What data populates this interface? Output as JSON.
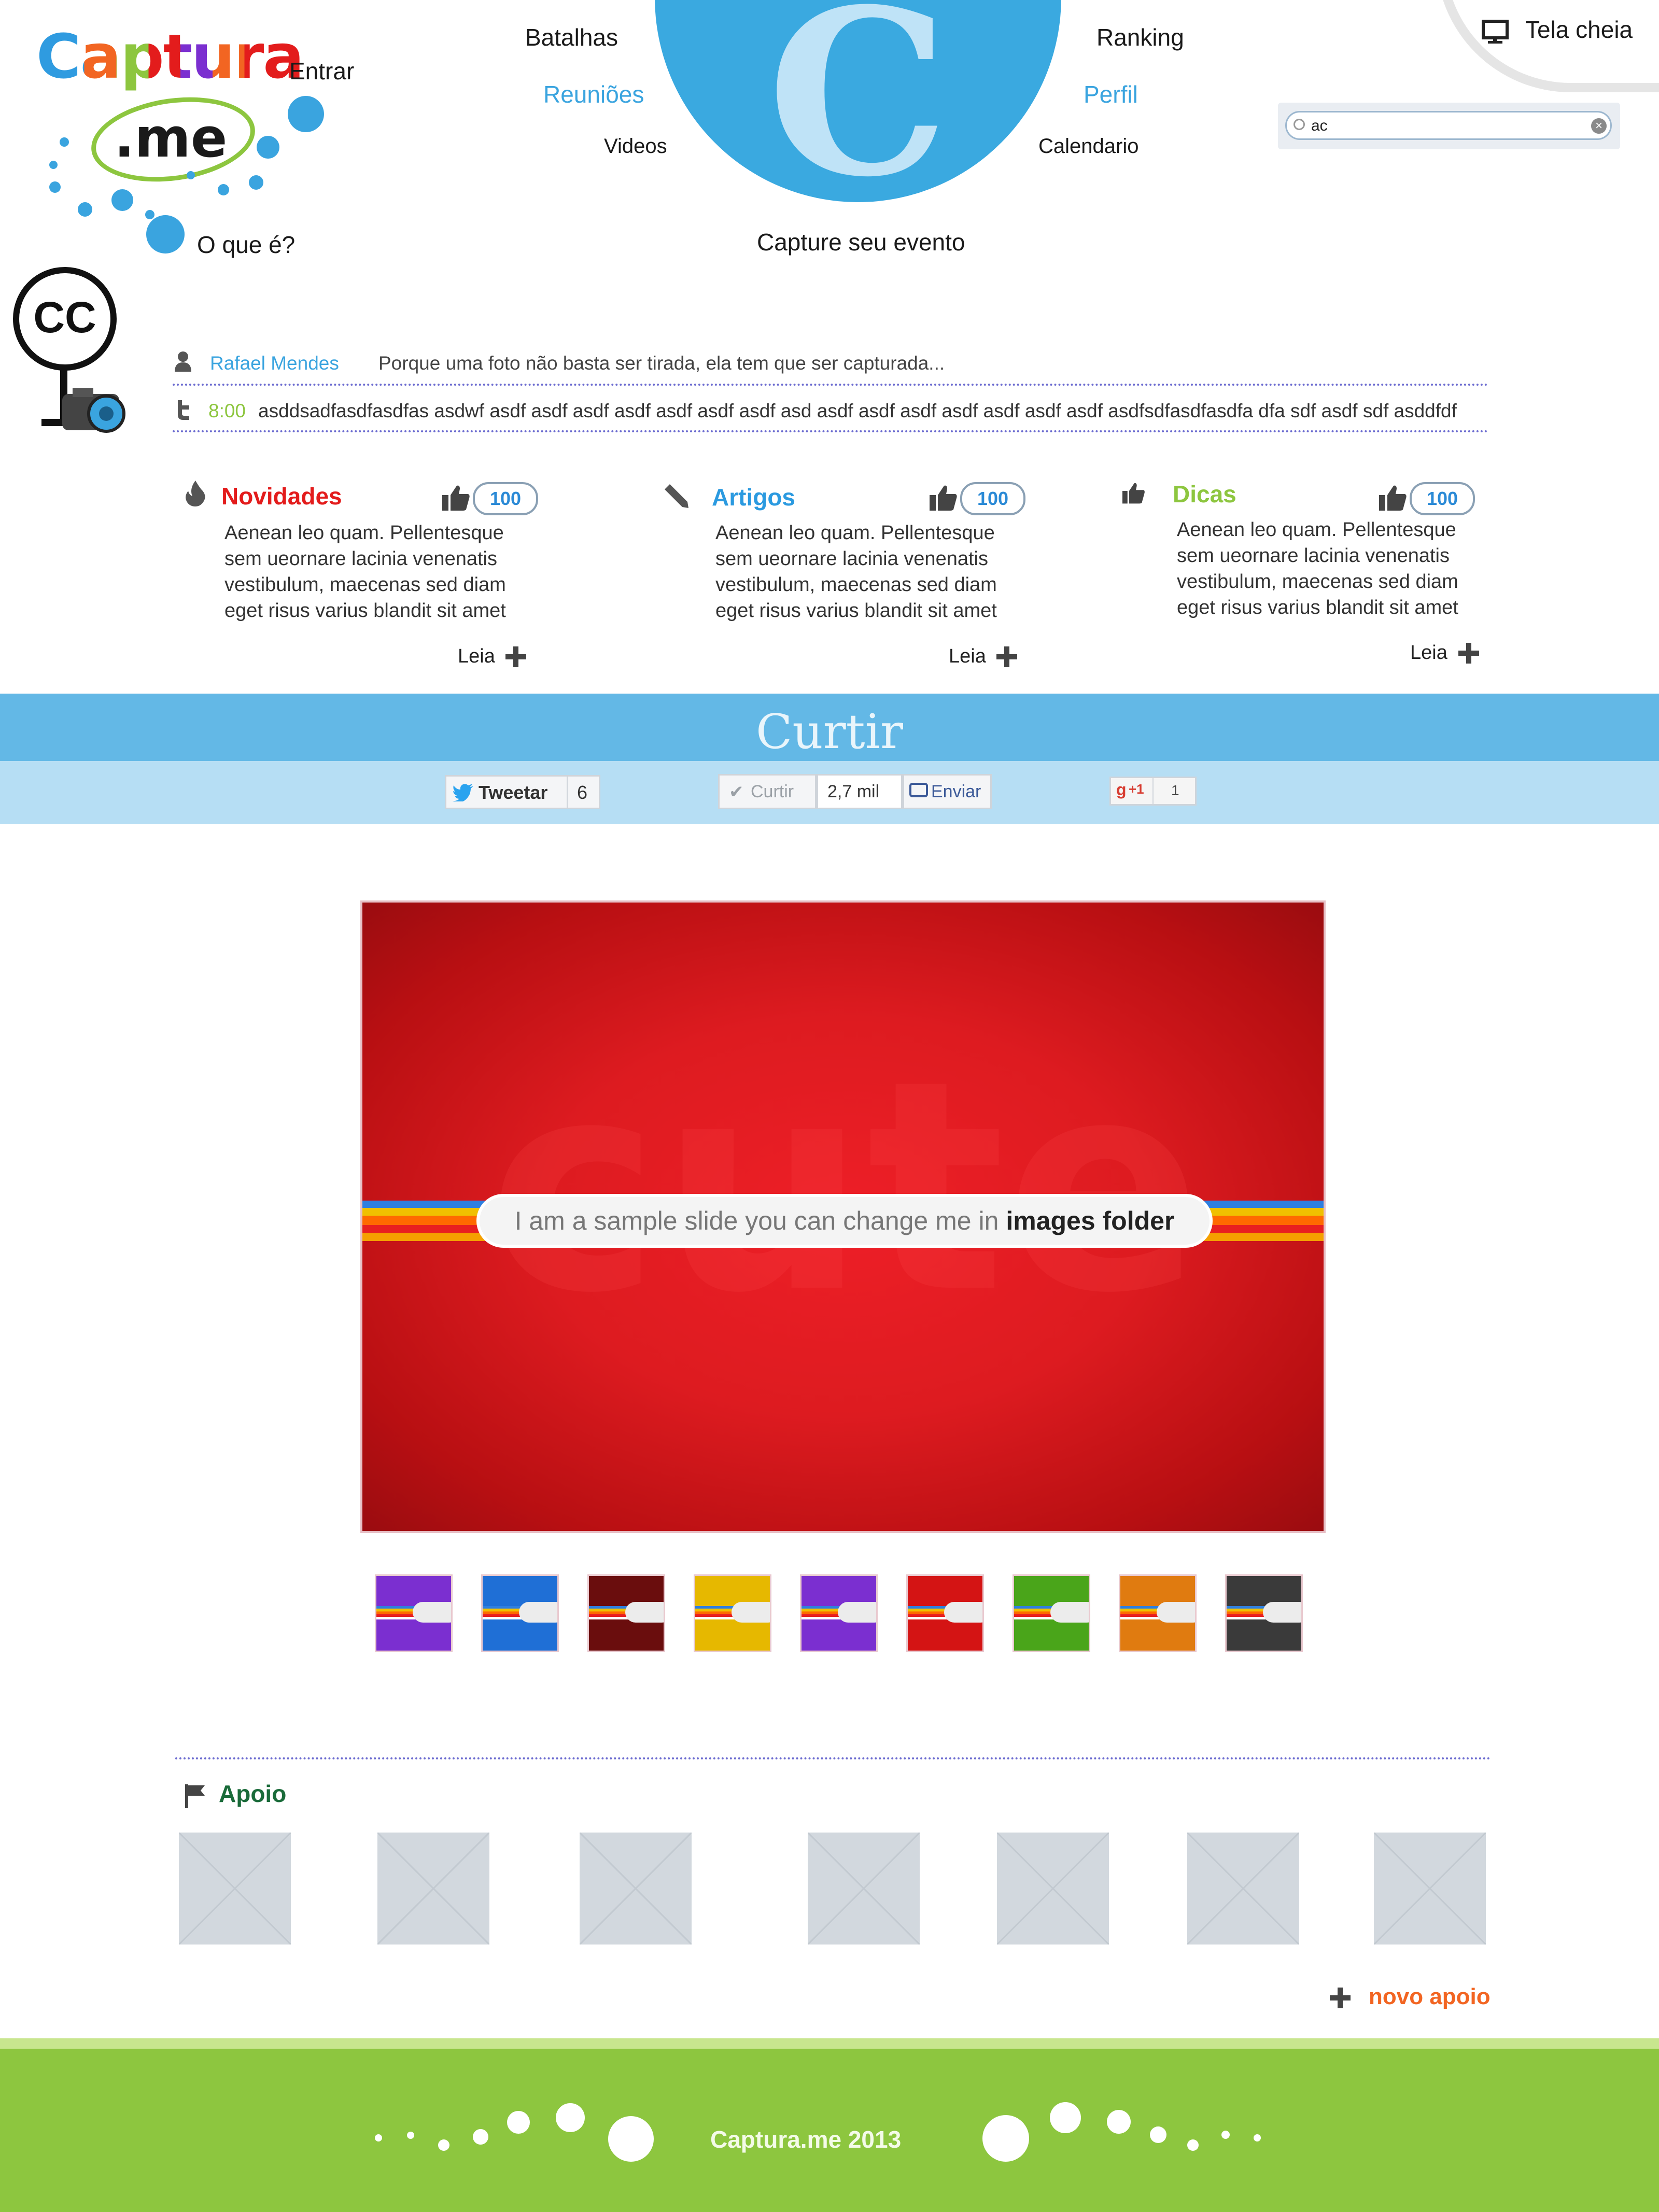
{
  "brand": {
    "logo_top": "Captura",
    "logo_bottom": ".me",
    "center_letter": "C",
    "cc_badge": "CC",
    "colors": {
      "blue": "#3aa4df",
      "green": "#8dc63f",
      "red": "#e31c1c",
      "orange": "#f26522"
    }
  },
  "header": {
    "login": "Entrar",
    "what_is": "O que é?",
    "nav_left": [
      "Batalhas",
      "Reuniões",
      "Videos"
    ],
    "nav_right": [
      "Ranking",
      "Perfil",
      "Calendario"
    ],
    "tagline": "Capture seu evento",
    "fullscreen": "Tela cheia",
    "search_value": "ac"
  },
  "feed": {
    "user_name": "Rafael Mendes",
    "quote": "Porque uma foto não basta ser tirada, ela tem que ser capturada...",
    "tweet_time": "8:00",
    "tweet_text": "asddsadfasdfasdfas asdwf asdf asdf asdf asdf asdf asdf asdf asd asdf asdf asdf asdf asdf asdf asdf asdfsdfasdfasdfa dfa sdf asdf sdf asddfdf"
  },
  "columns": [
    {
      "title": "Novidades",
      "icon": "flame-icon",
      "color": "#e31c1c",
      "likes": "100",
      "text": [
        "Aenean leo quam. Pellentesque",
        "sem ueornare lacinia venenatis",
        "vestibulum, maecenas sed diam",
        "eget risus varius blandit sit amet"
      ],
      "more": "Leia"
    },
    {
      "title": "Artigos",
      "icon": "pencil-icon",
      "color": "#2b9ae0",
      "likes": "100",
      "text": [
        "Aenean leo quam. Pellentesque",
        "sem ueornare lacinia venenatis",
        "vestibulum, maecenas sed diam",
        "eget risus varius blandit sit amet"
      ],
      "more": "Leia"
    },
    {
      "title": "Dicas",
      "icon": "thumbs-up-icon",
      "color": "#8dc63f",
      "likes": "100",
      "text": [
        "Aenean leo quam. Pellentesque",
        "sem ueornare lacinia venenatis",
        "vestibulum, maecenas sed diam",
        "eget risus varius blandit sit amet"
      ],
      "more": "Leia"
    }
  ],
  "share": {
    "title": "Curtir",
    "tweet_label": "Tweetar",
    "tweet_count": "6",
    "fb_like": "Curtir",
    "fb_count": "2,7 mil",
    "fb_send": "Enviar",
    "gplus_label": "+1",
    "gplus_count": "1"
  },
  "slider": {
    "slide_text": "I am a sample slide you can change me in",
    "slide_text_bold": "images folder",
    "watermark": "cute",
    "thumb_colors": [
      "#7b2fd0",
      "#1f6fd6",
      "#6a0d0d",
      "#e6b800",
      "#7b2fd0",
      "#d41414",
      "#4aa51a",
      "#e07b10",
      "#3a3a3a"
    ]
  },
  "support": {
    "title": "Apoio",
    "add_label": "novo apoio",
    "sponsor_count": 7
  },
  "footer": {
    "copyright": "Captura.me 2013"
  }
}
